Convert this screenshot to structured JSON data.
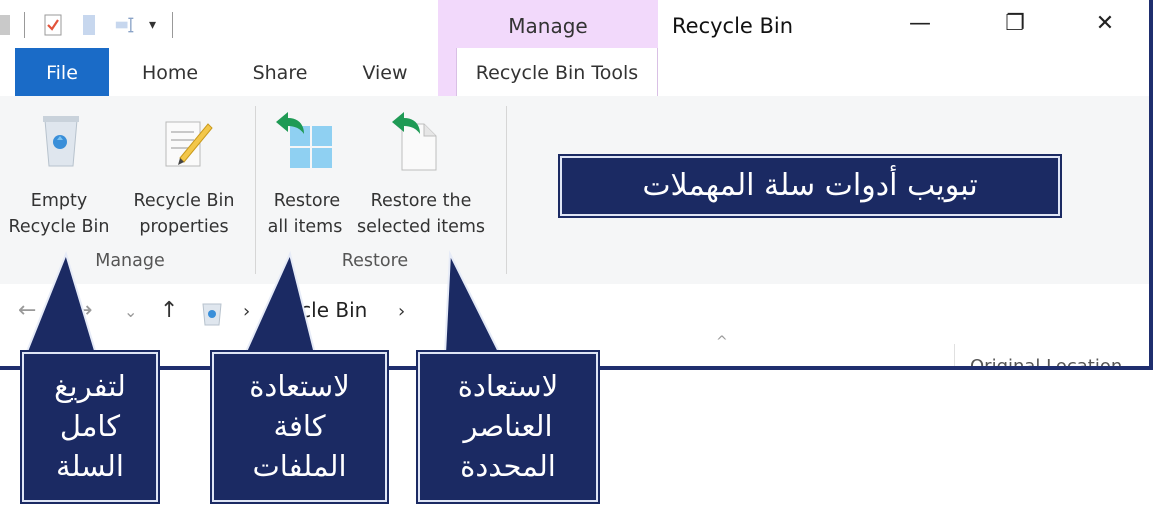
{
  "titlebar": {
    "manage_label": "Manage",
    "window_title": "Recycle Bin",
    "minimize": "—",
    "restore": "❐",
    "close": "✕"
  },
  "tabs": [
    {
      "label": "File"
    },
    {
      "label": "Home"
    },
    {
      "label": "Share"
    },
    {
      "label": "View"
    },
    {
      "label": "Recycle Bin Tools"
    }
  ],
  "ribbon": {
    "buttons": [
      {
        "line1": "Empty",
        "line2": "Recycle Bin",
        "icon": "recycle-bin-icon"
      },
      {
        "line1": "Recycle Bin",
        "line2": "properties",
        "icon": "properties-icon"
      },
      {
        "line1": "Restore",
        "line2": "all items",
        "icon": "restore-all-icon"
      },
      {
        "line1": "Restore the",
        "line2": "selected items",
        "icon": "restore-selected-icon"
      }
    ],
    "groups": [
      {
        "label": "Manage"
      },
      {
        "label": "Restore"
      }
    ]
  },
  "address": {
    "back": "←",
    "forward": "→",
    "dropdown": "⌄",
    "up": "↑",
    "path": "Recycle Bin",
    "chevron": "›",
    "path_text": "ecycle Bin",
    "trailing_chevron": "›"
  },
  "file_list": {
    "column_header": "Original Location",
    "sort_caret": "^"
  },
  "callouts": {
    "tab_note": "تبويب أدوات سلة المهملات",
    "empty_bin": [
      "لتفريغ",
      "كامل",
      "السلة"
    ],
    "restore_all": [
      "لاستعادة",
      "كافة",
      "الملفات"
    ],
    "restore_selected": [
      "لاستعادة",
      "العناصر",
      "المحددة"
    ]
  },
  "colors": {
    "file_tab": "#1a6bc7",
    "contextual_tab": "#f2d9fb",
    "callout_bg": "#1b2a63",
    "restore_arrow": "#1f9a55"
  }
}
